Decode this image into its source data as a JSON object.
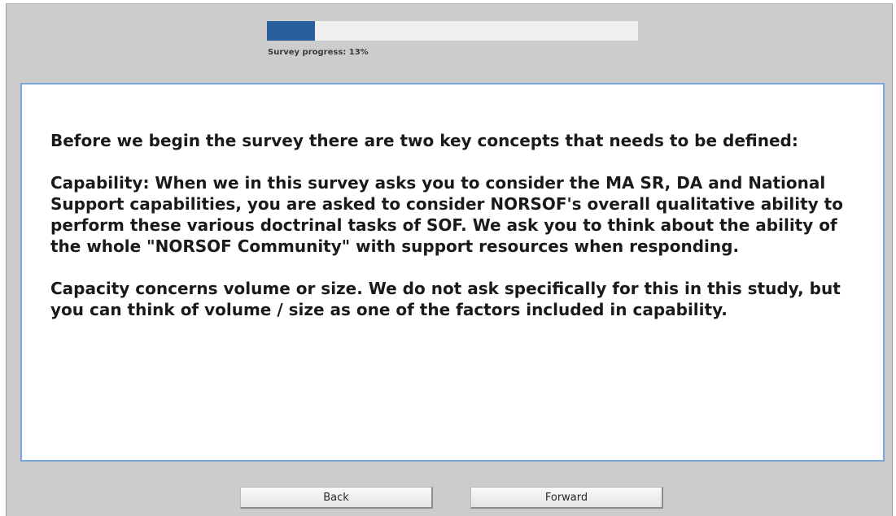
{
  "survey": {
    "progress_label": "Survey progress: 13%",
    "progress_fraction": 0.13,
    "accent_color": "#2a5f9e"
  },
  "content": {
    "paragraphs": [
      "Before we begin the survey there are two key concepts that needs to be defined:",
      "Capability: When we in this survey asks you to consider the MA SR, DA and National Support capabilities, you are asked to consider NORSOF's overall qualitative ability to perform these various doctrinal tasks of SOF. We ask you to think about the ability of the whole \"NORSOF Community\" with support resources when responding.",
      "Capacity concerns volume or size. We do not ask specifically for this in this study, but you can think of volume / size as one of the factors included in capability."
    ]
  },
  "navigation": {
    "back_label": "Back",
    "forward_label": "Forward"
  }
}
